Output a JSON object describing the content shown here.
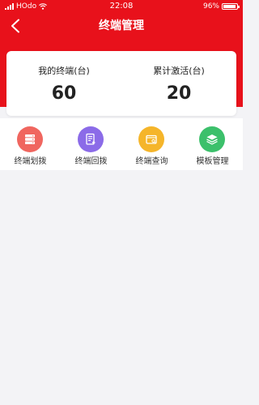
{
  "status_bar": {
    "carrier": "HOdo",
    "time": "22:08",
    "battery_percent": "96%",
    "battery_level": 0.96
  },
  "nav": {
    "title": "终端管理",
    "back_icon": "chevron-left-icon"
  },
  "stats": {
    "my_terminals_label": "我的终端(台)",
    "my_terminals_value": "60",
    "activated_label": "累计激活(台)",
    "activated_value": "20"
  },
  "menu": {
    "items": [
      {
        "label": "终端划拨",
        "icon": "server-stack-icon",
        "color": "#f0665f"
      },
      {
        "label": "终端回拨",
        "icon": "document-return-icon",
        "color": "#8b6be8"
      },
      {
        "label": "终端查询",
        "icon": "wallet-search-icon",
        "color": "#f5b52a"
      },
      {
        "label": "模板管理",
        "icon": "layers-icon",
        "color": "#3cc06b"
      }
    ]
  },
  "colors": {
    "brand_red": "#e8111b",
    "page_bg": "#f3f3f6"
  }
}
